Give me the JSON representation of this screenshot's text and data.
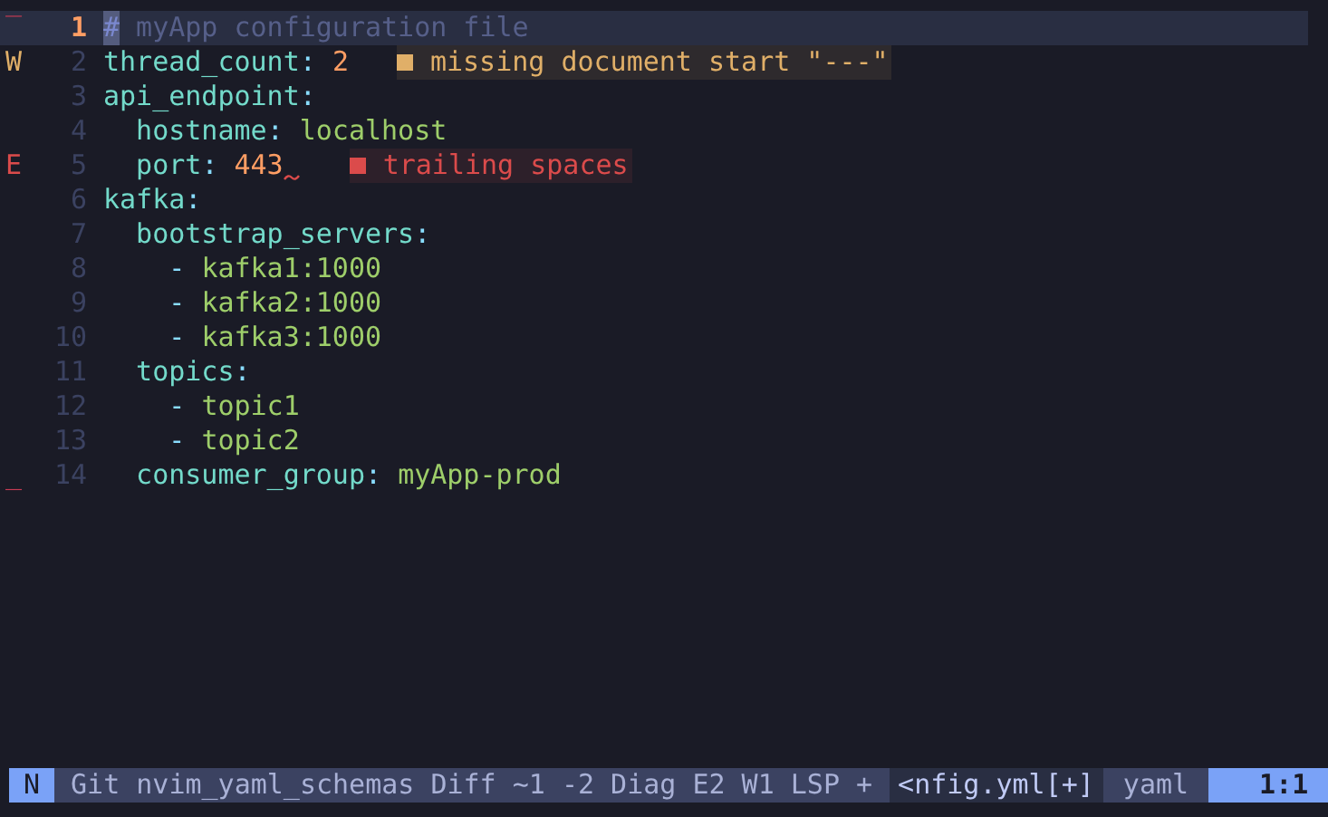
{
  "editor": {
    "lines": [
      {
        "number": "1",
        "current": true,
        "sign": {
          "kind": "git_delete_top",
          "text": "‾"
        },
        "segments": [
          {
            "kind": "cursor",
            "text": "#"
          },
          {
            "kind": "comment",
            "text": " myApp configuration file"
          }
        ]
      },
      {
        "number": "2",
        "current": false,
        "sign": {
          "kind": "warning",
          "text": "W"
        },
        "segments": [
          {
            "kind": "key",
            "text": "thread_count"
          },
          {
            "kind": "punct",
            "text": ": "
          },
          {
            "kind": "number",
            "text": "2"
          }
        ],
        "diagnostic": {
          "kind": "warning",
          "text": "missing document start \"---\""
        }
      },
      {
        "number": "3",
        "current": false,
        "segments": [
          {
            "kind": "key",
            "text": "api_endpoint"
          },
          {
            "kind": "punct",
            "text": ":"
          }
        ]
      },
      {
        "number": "4",
        "current": false,
        "segments": [
          {
            "kind": "key",
            "text": "  hostname"
          },
          {
            "kind": "punct",
            "text": ": "
          },
          {
            "kind": "string",
            "text": "localhost"
          }
        ]
      },
      {
        "number": "5",
        "current": false,
        "sign": {
          "kind": "error",
          "text": "E"
        },
        "undercurl": true,
        "segments": [
          {
            "kind": "key",
            "text": "  port"
          },
          {
            "kind": "punct",
            "text": ": "
          },
          {
            "kind": "number",
            "text": "443"
          }
        ],
        "diagnostic": {
          "kind": "error",
          "text": "trailing spaces"
        }
      },
      {
        "number": "6",
        "current": false,
        "segments": [
          {
            "kind": "key",
            "text": "kafka"
          },
          {
            "kind": "punct",
            "text": ":"
          }
        ]
      },
      {
        "number": "7",
        "current": false,
        "segments": [
          {
            "kind": "key",
            "text": "  bootstrap_servers"
          },
          {
            "kind": "punct",
            "text": ":"
          }
        ]
      },
      {
        "number": "8",
        "current": false,
        "segments": [
          {
            "kind": "punct",
            "text": "    - "
          },
          {
            "kind": "string",
            "text": "kafka1:1000"
          }
        ]
      },
      {
        "number": "9",
        "current": false,
        "segments": [
          {
            "kind": "punct",
            "text": "    - "
          },
          {
            "kind": "string",
            "text": "kafka2:1000"
          }
        ]
      },
      {
        "number": "10",
        "current": false,
        "segments": [
          {
            "kind": "punct",
            "text": "    - "
          },
          {
            "kind": "string",
            "text": "kafka3:1000"
          }
        ]
      },
      {
        "number": "11",
        "current": false,
        "segments": [
          {
            "kind": "key",
            "text": "  topics"
          },
          {
            "kind": "punct",
            "text": ":"
          }
        ]
      },
      {
        "number": "12",
        "current": false,
        "segments": [
          {
            "kind": "punct",
            "text": "    - "
          },
          {
            "kind": "string",
            "text": "topic1"
          }
        ]
      },
      {
        "number": "13",
        "current": false,
        "segments": [
          {
            "kind": "punct",
            "text": "    - "
          },
          {
            "kind": "string",
            "text": "topic2"
          }
        ]
      },
      {
        "number": "14",
        "current": false,
        "sign": {
          "kind": "git_delete",
          "text": "_"
        },
        "segments": [
          {
            "kind": "key",
            "text": "  consumer_group"
          },
          {
            "kind": "punct",
            "text": ": "
          },
          {
            "kind": "string",
            "text": "myApp-prod"
          }
        ]
      }
    ]
  },
  "status_bar": {
    "sections": [
      {
        "kind": "mode",
        "text": "N"
      },
      {
        "kind": "info",
        "text": "Git nvim_yaml_schemas Diff ~1 -2 Diag E2 W1 LSP +"
      },
      {
        "kind": "file",
        "text": "<nfig.yml[+]"
      },
      {
        "kind": "filetype",
        "text": "yaml"
      },
      {
        "kind": "position",
        "text": "1:1"
      }
    ]
  }
}
